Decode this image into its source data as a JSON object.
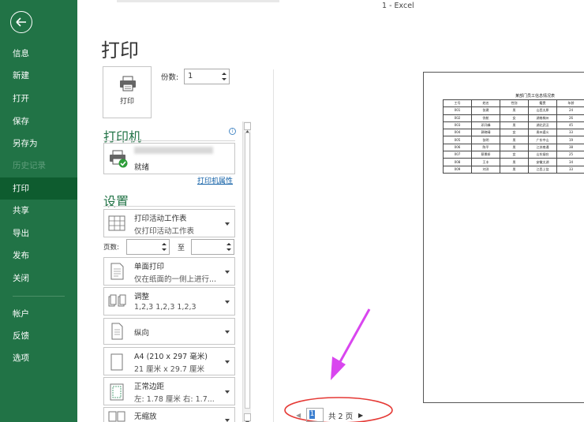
{
  "title_bar": {
    "doc_title": "1  -  Excel"
  },
  "nav": {
    "items": [
      {
        "label": "信息"
      },
      {
        "label": "新建"
      },
      {
        "label": "打开"
      },
      {
        "label": "保存"
      },
      {
        "label": "另存为"
      },
      {
        "label": "历史记录",
        "disabled": true
      },
      {
        "label": "打印",
        "active": true
      },
      {
        "label": "共享"
      },
      {
        "label": "导出"
      },
      {
        "label": "发布"
      },
      {
        "label": "关闭"
      },
      {
        "label": "帐户"
      },
      {
        "label": "反馈"
      },
      {
        "label": "选项"
      }
    ]
  },
  "print": {
    "heading": "打印",
    "print_button_label": "打印",
    "copies_label": "份数:",
    "copies_value": "1"
  },
  "printer": {
    "section_title": "打印机",
    "status": "就绪",
    "properties_link": "打印机属性"
  },
  "settings": {
    "section_title": "设置",
    "scope": {
      "main": "打印活动工作表",
      "sub": "仅打印活动工作表"
    },
    "pages_label": "页数:",
    "to_label": "至",
    "sides": {
      "main": "单面打印",
      "sub": "仅在纸面的一侧上进行..."
    },
    "collate": {
      "main": "调整",
      "sub": "1,2,3    1,2,3    1,2,3"
    },
    "orientation": {
      "main": "纵向"
    },
    "paper": {
      "main": "A4 (210 x 297 毫米)",
      "sub": "21 厘米 x 29.7 厘米"
    },
    "margins": {
      "main": "正常边距",
      "sub": "左: 1.78 厘米    右: 1.7..."
    },
    "scaling": {
      "main": "无缩放"
    }
  },
  "preview": {
    "sheet_title": "某部门员工信息情况表",
    "table": [
      [
        "工号",
        "姓名",
        "性别",
        "籍贯",
        "年龄"
      ],
      [
        "001",
        "张建",
        "男",
        "山西太原",
        "24"
      ],
      [
        "002",
        "徐航",
        "女",
        "湖南株州",
        "26"
      ],
      [
        "003",
        "邓开峰",
        "男",
        "湖北武汉",
        "45"
      ],
      [
        "004",
        "郭晓晴",
        "女",
        "贵州遵义",
        "33"
      ],
      [
        "005",
        "张明",
        "男",
        "广东中山",
        "19"
      ],
      [
        "006",
        "陈平",
        "男",
        "江苏南通",
        "38"
      ],
      [
        "007",
        "蔡景妍",
        "女",
        "山东烟台",
        "25"
      ],
      [
        "008",
        "王丰",
        "男",
        "安徽太湖",
        "34"
      ],
      [
        "009",
        "刘洋",
        "男",
        "江西上饶",
        "33"
      ]
    ],
    "current_page": "1",
    "total_pages": "共 2 页"
  },
  "colors": {
    "excel_green": "#217346",
    "annotation_red": "#e53935",
    "annotation_arrow": "#d946ef"
  }
}
